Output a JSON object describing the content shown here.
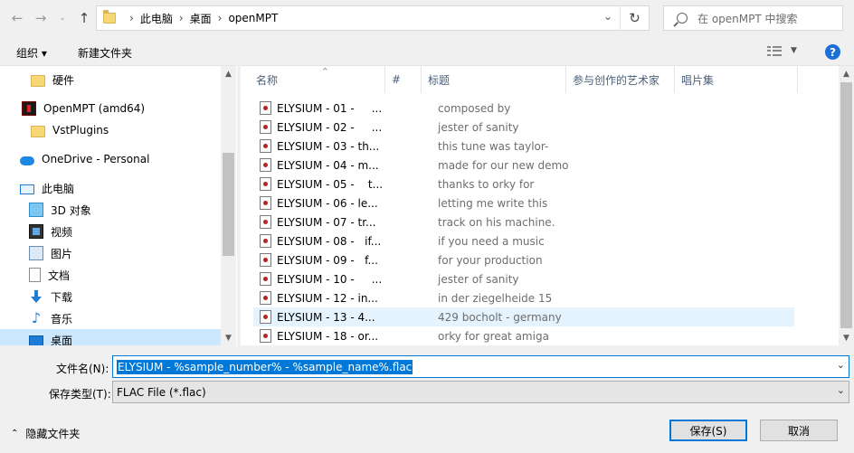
{
  "address_bar": {
    "crumbs": [
      "此电脑",
      "桌面",
      "openMPT"
    ],
    "search_placeholder": "在 openMPT 中搜索"
  },
  "toolbar": {
    "organize_label": "组织 ▾",
    "new_folder_label": "新建文件夹"
  },
  "nav_pane": {
    "items": [
      {
        "label": "硬件",
        "icon": "folder-icon"
      },
      {
        "label": "OpenMPT (amd64)",
        "icon": "openmpt-icon"
      },
      {
        "label": "VstPlugins",
        "icon": "folder-icon"
      },
      {
        "label": "OneDrive - Personal",
        "icon": "onedrive-icon"
      },
      {
        "label": "此电脑",
        "icon": "this-pc-icon"
      },
      {
        "label": "3D 对象",
        "icon": "3d-objects-icon"
      },
      {
        "label": "视频",
        "icon": "video-icon"
      },
      {
        "label": "图片",
        "icon": "pictures-icon"
      },
      {
        "label": "文档",
        "icon": "documents-icon"
      },
      {
        "label": "下载",
        "icon": "downloads-icon"
      },
      {
        "label": "音乐",
        "icon": "music-icon"
      },
      {
        "label": "桌面",
        "icon": "desktop-icon",
        "selected": true
      }
    ]
  },
  "file_list": {
    "columns": [
      "名称",
      "#",
      "标题",
      "参与创作的艺术家",
      "唱片集"
    ],
    "rows": [
      {
        "name": "ELYSIUM - 01 -     ...",
        "title": "composed by"
      },
      {
        "name": "ELYSIUM - 02 -     ...",
        "title": "jester of sanity"
      },
      {
        "name": "ELYSIUM - 03 - th...",
        "title": "this tune was taylor-"
      },
      {
        "name": "ELYSIUM - 04 - m...",
        "title": "made for our new demo"
      },
      {
        "name": "ELYSIUM - 05 -    t...",
        "title": "thanks to orky for"
      },
      {
        "name": "ELYSIUM - 06 - le...",
        "title": "letting me write this"
      },
      {
        "name": "ELYSIUM - 07 - tr...",
        "title": "track on his machine."
      },
      {
        "name": "ELYSIUM - 08 -   if...",
        "title": "if you need a music"
      },
      {
        "name": "ELYSIUM - 09 -   f...",
        "title": "for your production"
      },
      {
        "name": "ELYSIUM - 10 -     ...",
        "title": "jester of sanity"
      },
      {
        "name": "ELYSIUM - 12 - in...",
        "title": "in der ziegelheide 15"
      },
      {
        "name": "ELYSIUM - 13 - 4...",
        "title": "429 bocholt - germany",
        "hovered": true
      },
      {
        "name": "ELYSIUM - 18 - or...",
        "title": "orky for great amiga"
      }
    ]
  },
  "save_form": {
    "filename_label": "文件名(N):",
    "filename_value": "ELYSIUM - %sample_number% - %sample_name%.flac",
    "filetype_label": "保存类型(T):",
    "filetype_value": "FLAC File (*.flac)"
  },
  "footer": {
    "hide_folders_label": "隐藏文件夹",
    "save_label": "保存(S)",
    "cancel_label": "取消"
  },
  "colors": {
    "accent": "#0078d7",
    "selection": "#cce8ff",
    "hover_row": "#e5f3ff"
  }
}
